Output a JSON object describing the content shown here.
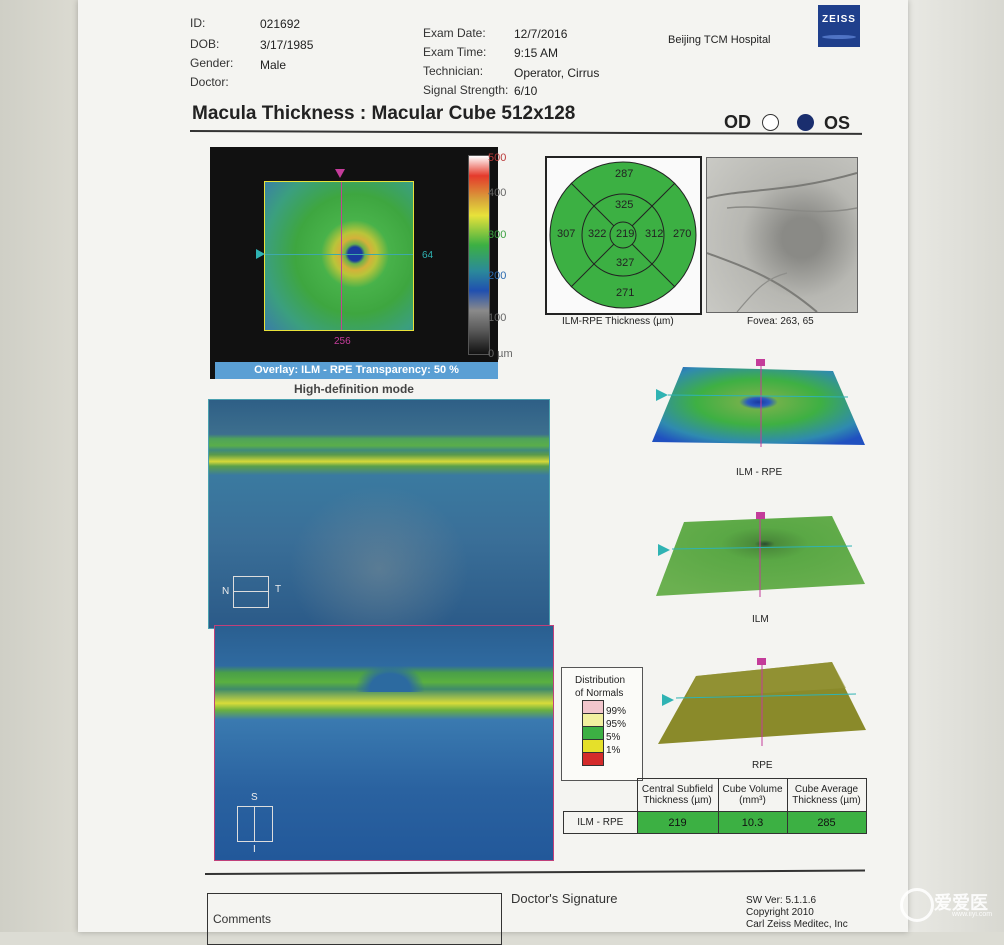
{
  "patient": {
    "id_label": "ID:",
    "id": "021692",
    "dob_label": "DOB:",
    "dob": "3/17/1985",
    "gender_label": "Gender:",
    "gender": "Male",
    "doctor_label": "Doctor:"
  },
  "exam": {
    "date_label": "Exam Date:",
    "date": "12/7/2016",
    "time_label": "Exam Time:",
    "time": "9:15 AM",
    "technician_label": "Technician:",
    "technician": "Operator, Cirrus",
    "signal_label": "Signal Strength:",
    "signal": "6/10"
  },
  "hospital": "Beijing TCM Hospital",
  "brand": "ZEISS",
  "title": "Macula Thickness : Macular Cube 512x128",
  "eye": {
    "od_label": "OD",
    "os_label": "OS",
    "selected": "OS"
  },
  "thickness_map": {
    "scale_labels": [
      "500",
      "400",
      "300",
      "200",
      "100",
      "0 µm"
    ],
    "marker_right": "64",
    "marker_bottom": "256",
    "overlay": "Overlay: ILM - RPE  Transparency: 50 %",
    "mode": "High-definition mode"
  },
  "etdrs": {
    "caption": "ILM-RPE Thickness (µm)",
    "outer_superior": "287",
    "outer_temporal": "307",
    "outer_nasal": "270",
    "outer_inferior": "271",
    "inner_superior": "325",
    "inner_temporal": "322",
    "inner_nasal": "312",
    "inner_inferior": "327",
    "center": "219"
  },
  "fundus": {
    "caption": "Fovea: 263, 65"
  },
  "surfaces": {
    "ilm_rpe": "ILM - RPE",
    "ilm": "ILM",
    "rpe": "RPE"
  },
  "bscan": {
    "h_left": "N",
    "h_right": "T",
    "v_top": "S",
    "v_bottom": "I"
  },
  "legend": {
    "title_line1": "Distribution",
    "title_line2": "of Normals",
    "items": [
      "99%",
      "95%",
      "5%",
      "1%"
    ],
    "colors": [
      "#f2c6cc",
      "#f2f0a0",
      "#3cb043",
      "#e5e02a",
      "#d42b2b"
    ]
  },
  "summary": {
    "headers": [
      "Central Subfield Thickness (µm)",
      "Cube Volume (mm³)",
      "Cube Average Thickness (µm)"
    ],
    "row_label": "ILM - RPE",
    "values": [
      "219",
      "10.3",
      "285"
    ]
  },
  "footer": {
    "signature": "Doctor's Signature",
    "comments": "Comments",
    "sw_ver": "SW Ver: 5.1.1.6",
    "copyright": "Copyright 2010",
    "company": "Carl Zeiss Meditec, Inc",
    "watermark": "爱爱医",
    "watermark_url": "www.iiyi.com"
  }
}
